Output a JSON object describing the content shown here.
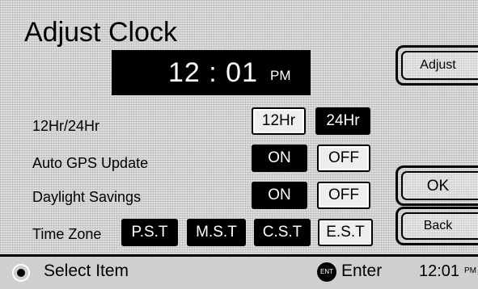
{
  "title": "Adjust Clock",
  "clock": {
    "time": "12 : 01",
    "ampm": "PM"
  },
  "rows": {
    "format": {
      "label": "12Hr/24Hr",
      "options": [
        "12Hr",
        "24Hr"
      ],
      "selected": "24Hr"
    },
    "gps": {
      "label": "Auto GPS Update",
      "options": [
        "ON",
        "OFF"
      ],
      "selected": "ON"
    },
    "dst": {
      "label": "Daylight Savings",
      "options": [
        "ON",
        "OFF"
      ],
      "selected": "ON"
    },
    "timezone": {
      "label": "Time Zone",
      "options": [
        "P.S.T",
        "M.S.T",
        "C.S.T",
        "E.S.T"
      ],
      "selected": [
        "P.S.T",
        "M.S.T",
        "C.S.T"
      ]
    }
  },
  "side_buttons": {
    "adjust": "Adjust",
    "ok": "OK",
    "back": "Back"
  },
  "status_bar": {
    "select_hint": "Select Item",
    "enter_icon": "ENT",
    "enter_hint": "Enter",
    "clock": "12:01",
    "clock_suffix": "PM"
  }
}
